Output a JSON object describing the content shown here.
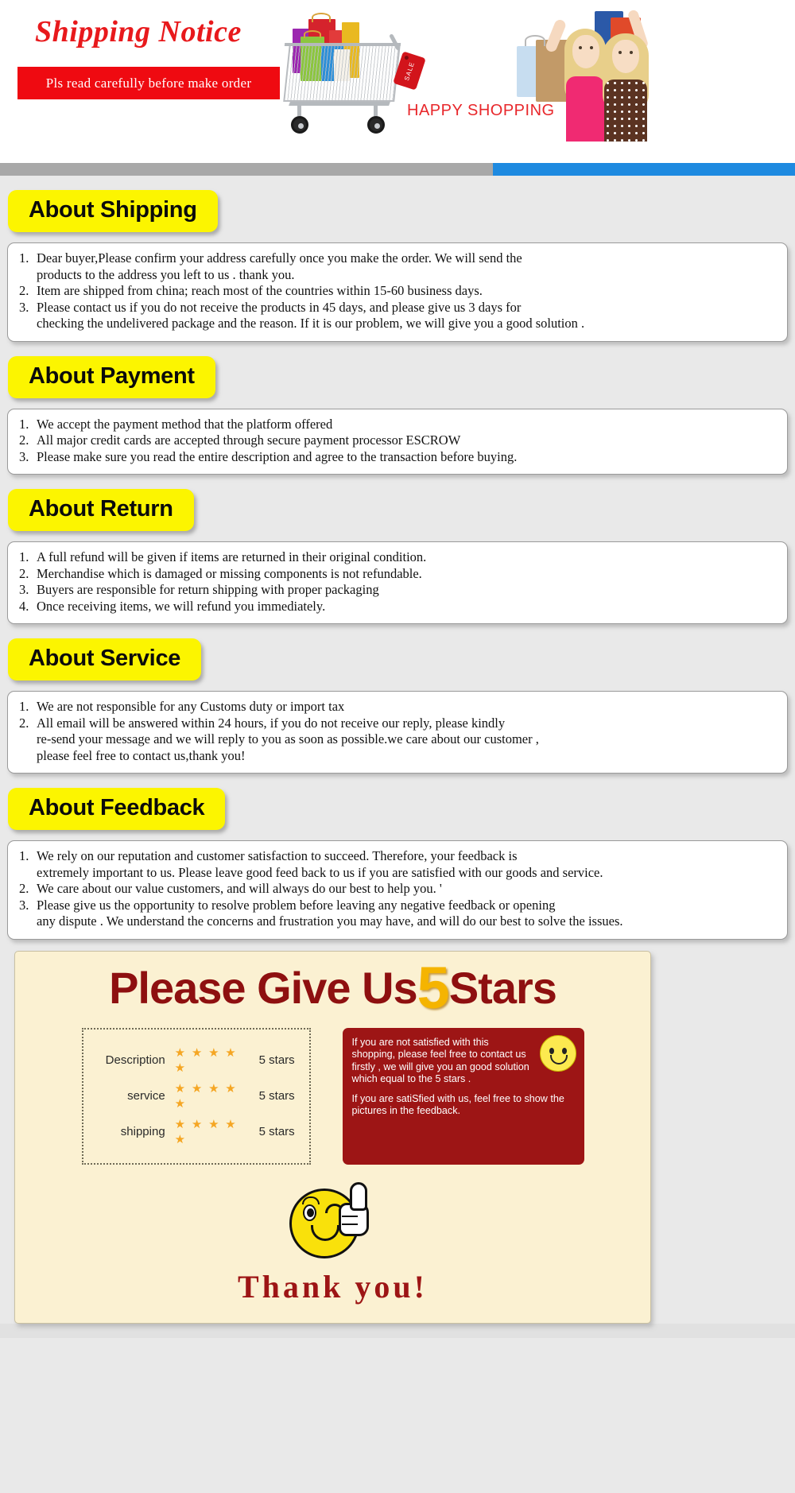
{
  "header": {
    "title": "Shipping Notice",
    "banner_text": "Pls read carefully before make order",
    "happy_shopping": "HAPPY SHOPPING",
    "sale_tag": "SALE",
    "accent_red": "#e8191c",
    "banner_bg": "#ef0a11",
    "divider_gray": "#a8a8a8",
    "divider_blue": "#1e8ae0"
  },
  "sections": [
    {
      "label": "About Shipping",
      "items": [
        {
          "num": "1.",
          "lines": [
            "Dear buyer,Please confirm your address carefully once you make the order. We will send the",
            "products to the address you left to us . thank you."
          ]
        },
        {
          "num": "2.",
          "lines": [
            "Item are shipped from china; reach most of the countries within 15-60 business days."
          ]
        },
        {
          "num": "3.",
          "lines": [
            "Please contact us if you do not receive the products in 45 days, and please give us 3 days for",
            "checking the undelivered package and the reason. If it is our problem, we will give you a good solution ."
          ]
        }
      ]
    },
    {
      "label": "About Payment",
      "items": [
        {
          "num": "1.",
          "lines": [
            "We accept the payment method that the platform offered"
          ]
        },
        {
          "num": "2.",
          "lines": [
            "All major credit cards are accepted through secure payment processor ESCROW"
          ]
        },
        {
          "num": "3.",
          "lines": [
            "Please make sure you read the entire description and agree to the transaction before buying."
          ]
        }
      ]
    },
    {
      "label": "About Return",
      "items": [
        {
          "num": "1.",
          "lines": [
            "A full refund will be given if items are returned in their original condition."
          ]
        },
        {
          "num": "2.",
          "lines": [
            "Merchandise which is damaged or missing components is not refundable."
          ]
        },
        {
          "num": "3.",
          "lines": [
            "Buyers are responsible for return shipping with proper packaging"
          ]
        },
        {
          "num": "4.",
          "lines": [
            "Once receiving items, we will refund you immediately."
          ]
        }
      ]
    },
    {
      "label": "About Service",
      "items": [
        {
          "num": "1.",
          "lines": [
            "We are not responsible for any Customs duty or import tax"
          ]
        },
        {
          "num": "2.",
          "lines": [
            "All email will be answered within 24 hours, if you do not receive our reply, please kindly",
            "re-send your message and we will reply to you as soon as possible.we care about our customer ,",
            "please feel free to contact us,thank you!"
          ]
        }
      ]
    },
    {
      "label": "About Feedback",
      "items": [
        {
          "num": "1.",
          "lines": [
            "We rely on our reputation and customer satisfaction to succeed. Therefore, your feedback is",
            "extremely important to us. Please leave good feed back to us if you are satisfied with our goods and service."
          ]
        },
        {
          "num": "2.",
          "lines": [
            "We care about our value customers, and will always do our best to help you. '"
          ]
        },
        {
          "num": "3.",
          "lines": [
            "Please give us the opportunity to resolve problem before leaving any negative feedback or opening",
            "any dispute . We understand the concerns and frustration you may have, and will do our best to solve the issues."
          ]
        }
      ]
    }
  ],
  "stars_panel": {
    "headline_pre": "Please Give Us",
    "headline_five": "5",
    "headline_post": "Stars",
    "ratings": [
      {
        "name": "Description",
        "stars": "★ ★ ★ ★ ★",
        "value": "5 stars"
      },
      {
        "name": "service",
        "stars": "★ ★ ★ ★ ★",
        "value": "5 stars"
      },
      {
        "name": "shipping",
        "stars": "★ ★ ★ ★ ★",
        "value": "5 stars"
      }
    ],
    "red_card": {
      "paragraph_1": "If you are not satisfied with this shopping, please feel free to contact us firstly , we will give you an good solution which equal to the 5 stars .",
      "paragraph_2": "If you are satiSfied with us, feel free to show the pictures in the feedback."
    },
    "thank_you": "Thank you!",
    "panel_bg": "#fbf1d2",
    "headline_color": "#8e1010",
    "five_color": "#f5b400",
    "card_bg": "#9d1515"
  }
}
